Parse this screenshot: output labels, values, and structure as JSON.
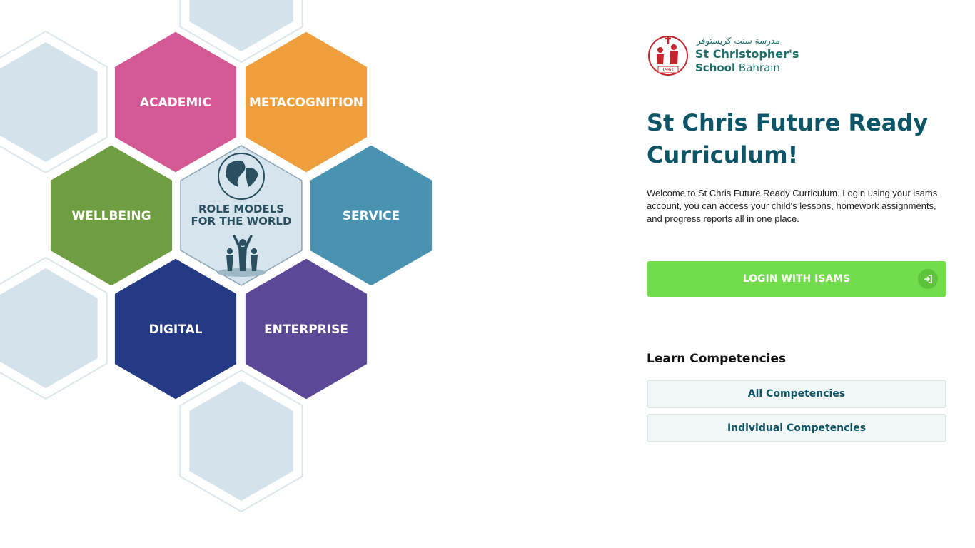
{
  "hexagons": {
    "academic": {
      "label": "ACADEMIC",
      "color": "#d35894"
    },
    "metacognition": {
      "label": "METACOGNITION",
      "color": "#ee9e3a"
    },
    "wellbeing": {
      "label": "WELLBEING",
      "color": "#6f9d42"
    },
    "service": {
      "label": "SERVICE",
      "color": "#4a93b0"
    },
    "digital": {
      "label": "DIGITAL",
      "color": "#243a84"
    },
    "enterprise": {
      "label": "ENTERPRISE",
      "color": "#5b4896"
    },
    "center": {
      "line1": "ROLE MODELS",
      "line2": "FOR THE WORLD"
    }
  },
  "logo": {
    "arabic": "مدرسة سنت كريستوفر",
    "line1": "St Christopher's",
    "line2_bold": "School",
    "line2_rest": " Bahrain",
    "year": "1961",
    "color": "#1f6e6a",
    "emblem_color": "#c4262e"
  },
  "heading": "St Chris Future Ready Curriculum!",
  "welcome_text": "Welcome to St Chris Future Ready Curriculum. Login using your isams account, you can access your child's lessons, homework assignments, and progress reports all in one place.",
  "login_button": {
    "label": "LOGIN WITH ISAMS",
    "icon": "login-arrow-icon",
    "color": "#72dd4c"
  },
  "competencies": {
    "heading": "Learn Competencies",
    "buttons": [
      "All Competencies",
      "Individual Competencies"
    ]
  }
}
